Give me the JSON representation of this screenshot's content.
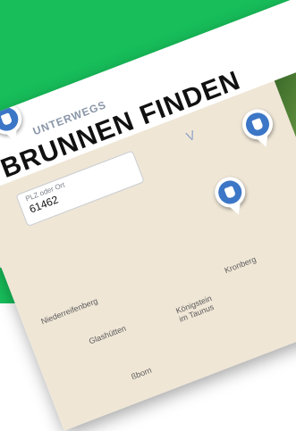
{
  "colors": {
    "accent": "#17be5a",
    "pin": "#3c76c6",
    "map": "#efe6d6"
  },
  "brand": {
    "tagline": "UNTERWEGS"
  },
  "hero": {
    "title": "BRUNNEN FINDEN"
  },
  "search": {
    "label": "PLZ oder Ort",
    "value": "61462"
  },
  "map": {
    "places": [
      {
        "name": "Niederreifenberg"
      },
      {
        "name": "Glashütten"
      },
      {
        "name": "Königstein",
        "line2": "im Taunus"
      },
      {
        "name": "Kronberg"
      },
      {
        "name": "ßborn"
      }
    ],
    "pins": [
      {
        "icon": "fountain-icon"
      },
      {
        "icon": "fountain-icon"
      },
      {
        "icon": "fountain-icon"
      }
    ]
  }
}
